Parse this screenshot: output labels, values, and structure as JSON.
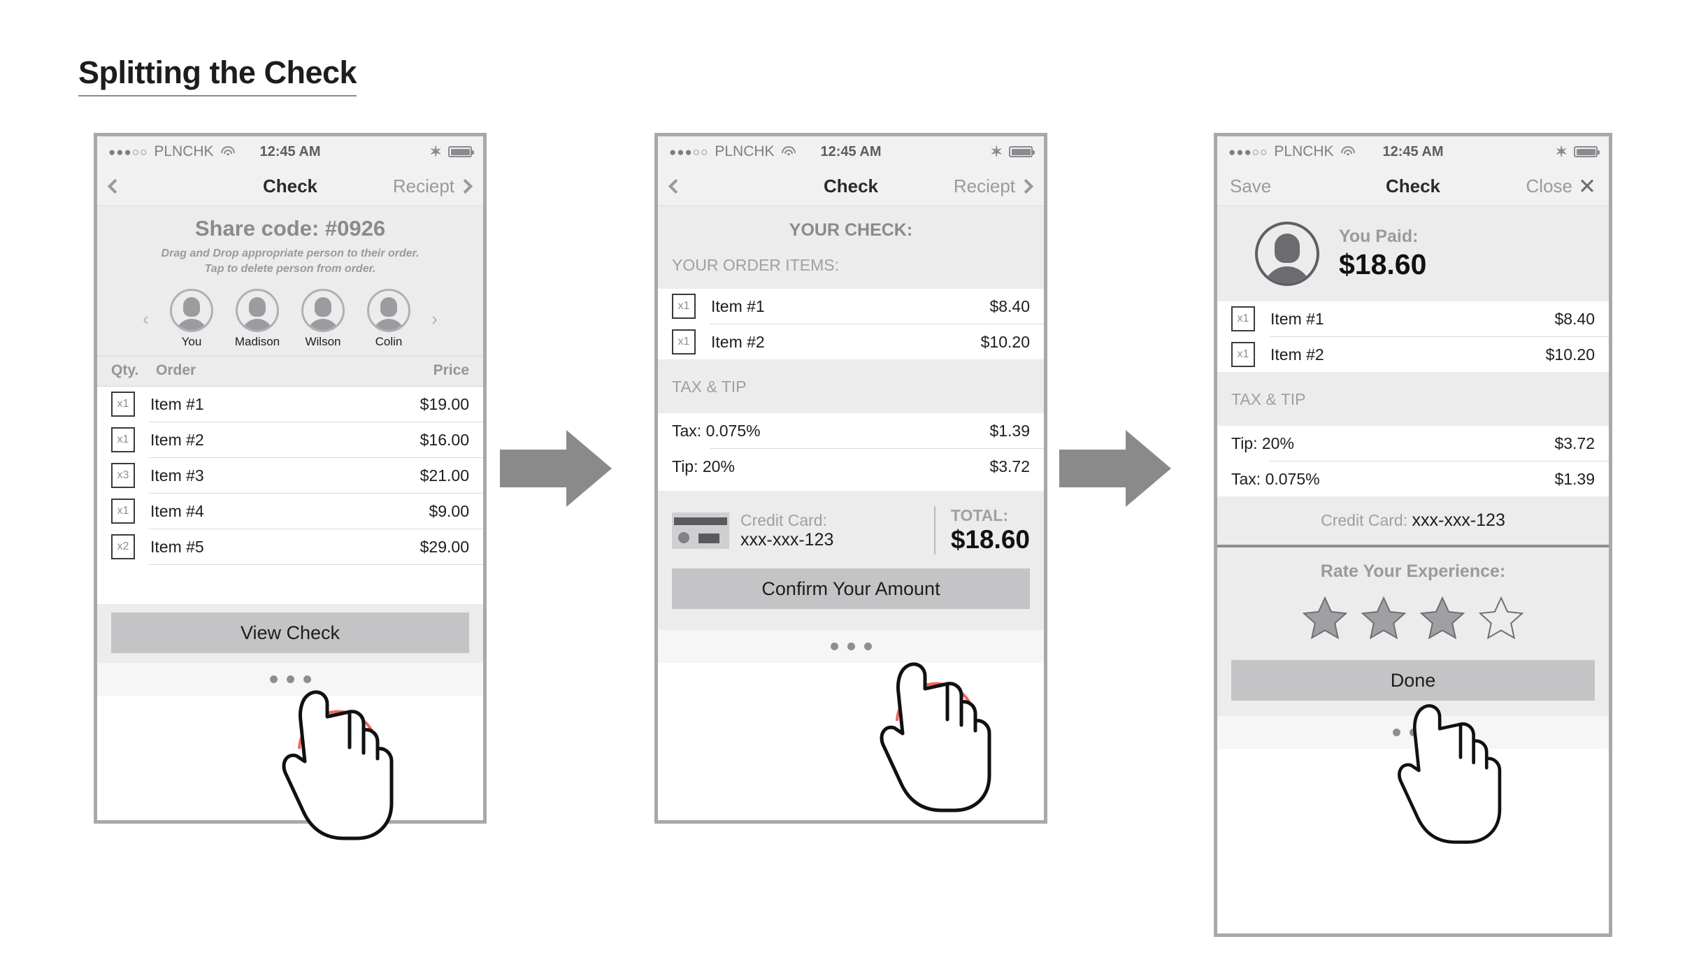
{
  "title": "Splitting the Check",
  "status_bar": {
    "signal_dots": "●●●○○",
    "carrier": "PLNCHK",
    "time": "12:45 AM",
    "bluetooth_glyph": "✶"
  },
  "phone1": {
    "nav": {
      "back_icon": "chevron-left",
      "title": "Check",
      "right_label": "Reciept",
      "forward_icon": "chevron-right"
    },
    "share": {
      "code_label": "Share code: #0926",
      "hint_line1": "Drag and Drop appropriate person to their order.",
      "hint_line2": "Tap to delete person from order."
    },
    "people": [
      {
        "name": "You"
      },
      {
        "name": "Madison"
      },
      {
        "name": "Wilson"
      },
      {
        "name": "Colin"
      }
    ],
    "people_prev_icon": "‹",
    "people_next_icon": "›",
    "table_headers": {
      "qty": "Qty.",
      "order": "Order",
      "price": "Price"
    },
    "items": [
      {
        "qty": "x1",
        "name": "Item #1",
        "price": "$19.00"
      },
      {
        "qty": "x1",
        "name": "Item #2",
        "price": "$16.00"
      },
      {
        "qty": "x3",
        "name": "Item #3",
        "price": "$21.00"
      },
      {
        "qty": "x1",
        "name": "Item #4",
        "price": "$9.00"
      },
      {
        "qty": "x2",
        "name": "Item #5",
        "price": "$29.00"
      }
    ],
    "button_label": "View Check"
  },
  "phone2": {
    "nav": {
      "back_icon": "chevron-left",
      "title": "Check",
      "right_label": "Reciept",
      "forward_icon": "chevron-right"
    },
    "heading": "YOUR CHECK:",
    "items_section_label": "YOUR ORDER ITEMS:",
    "items": [
      {
        "qty": "x1",
        "name": "Item #1",
        "price": "$8.40"
      },
      {
        "qty": "x1",
        "name": "Item #2",
        "price": "$10.20"
      }
    ],
    "tax_tip_label": "TAX & TIP",
    "tax_tip_rows": [
      {
        "label": "Tax: 0.075%",
        "value": "$1.39"
      },
      {
        "label": "Tip: 20%",
        "value": "$3.72"
      }
    ],
    "credit_card": {
      "label": "Credit Card:",
      "number": "xxx-xxx-123"
    },
    "total": {
      "label": "TOTAL:",
      "amount": "$18.60"
    },
    "button_label": "Confirm Your Amount"
  },
  "phone3": {
    "nav": {
      "left_label": "Save",
      "title": "Check",
      "right_label": "Close",
      "close_icon": "✕"
    },
    "paid": {
      "label": "You Paid:",
      "amount": "$18.60"
    },
    "items": [
      {
        "qty": "x1",
        "name": "Item #1",
        "price": "$8.40"
      },
      {
        "qty": "x1",
        "name": "Item #2",
        "price": "$10.20"
      }
    ],
    "tax_tip_label": "TAX & TIP",
    "tax_tip_rows": [
      {
        "label": "Tip: 20%",
        "value": "$3.72"
      },
      {
        "label": "Tax: 0.075%",
        "value": "$1.39"
      }
    ],
    "credit_card": {
      "label": "Credit Card:",
      "number": "xxx-xxx-123"
    },
    "rating": {
      "title": "Rate Your Experience:",
      "stars_total": 4,
      "stars_filled": 3
    },
    "button_label": "Done"
  },
  "colors": {
    "arrow_grey": "#8a8a8a",
    "tap_arc_red": "#f4645f",
    "button_grey": "#c4c4c6",
    "panel_grey": "#ececed",
    "star_filled": "#a0a0a4"
  }
}
